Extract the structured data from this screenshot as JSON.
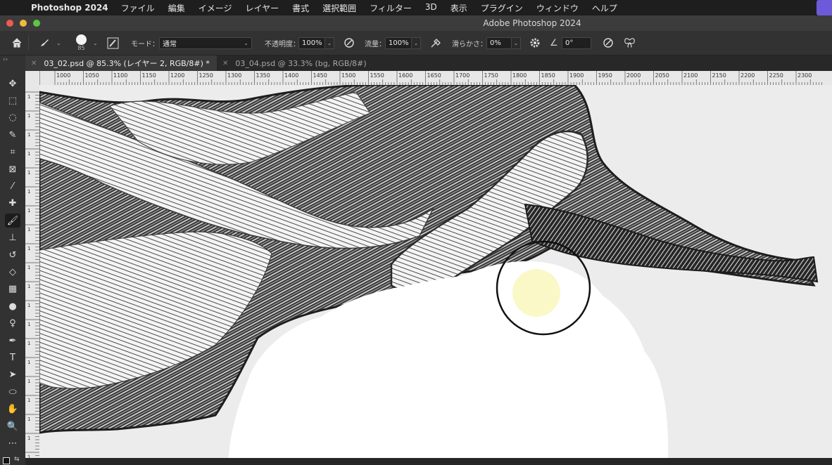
{
  "menubar": {
    "app_name": "Photoshop 2024",
    "items": [
      "ファイル",
      "編集",
      "イメージ",
      "レイヤー",
      "書式",
      "選択範囲",
      "フィルター",
      "3D",
      "表示",
      "プラグイン",
      "ウィンドウ",
      "ヘルプ"
    ]
  },
  "window": {
    "title": "Adobe Photoshop 2024"
  },
  "options_bar": {
    "brush_size": "85",
    "mode_label": "モード：",
    "mode_value": "通常",
    "opacity_label": "不透明度：",
    "opacity_value": "100%",
    "flow_label": "流量：",
    "flow_value": "100%",
    "smoothing_label": "滑らかさ：",
    "smoothing_value": "0%",
    "angle_value": "0°"
  },
  "tabs": [
    {
      "label": "03_02.psd @ 85.3% (レイヤー 2, RGB/8#) *",
      "active": true
    },
    {
      "label": "03_04.psd @ 33.3% (bg, RGB/8#)",
      "active": false
    }
  ],
  "ruler": {
    "h_ticks": [
      "1000",
      "1050",
      "1100",
      "1150",
      "1200",
      "1250",
      "1300",
      "1350",
      "1400",
      "1450",
      "1500",
      "1550",
      "1600",
      "1650",
      "1700",
      "1750",
      "1800",
      "1850",
      "1900",
      "1950",
      "2000",
      "2050",
      "2100",
      "2150",
      "2200",
      "2250",
      "2300"
    ],
    "v_ticks": [
      "1",
      "1",
      "1",
      "1",
      "1",
      "1",
      "1",
      "1",
      "1",
      "1",
      "1",
      "1",
      "1",
      "1",
      "1",
      "1",
      "1",
      "1",
      "1",
      "1"
    ]
  },
  "tools": [
    {
      "name": "move-tool-icon",
      "glyph": "✥"
    },
    {
      "name": "marquee-tool-icon",
      "glyph": "⬚"
    },
    {
      "name": "lasso-tool-icon",
      "glyph": "◌"
    },
    {
      "name": "quick-select-tool-icon",
      "glyph": "✎"
    },
    {
      "name": "crop-tool-icon",
      "glyph": "⌗"
    },
    {
      "name": "frame-tool-icon",
      "glyph": "⊠"
    },
    {
      "name": "eyedropper-tool-icon",
      "glyph": "⁄"
    },
    {
      "name": "healing-brush-tool-icon",
      "glyph": "✚"
    },
    {
      "name": "brush-tool-icon",
      "glyph": "🖌"
    },
    {
      "name": "clone-stamp-tool-icon",
      "glyph": "⊥"
    },
    {
      "name": "history-brush-tool-icon",
      "glyph": "↺"
    },
    {
      "name": "eraser-tool-icon",
      "glyph": "◇"
    },
    {
      "name": "gradient-tool-icon",
      "glyph": "▦"
    },
    {
      "name": "blur-tool-icon",
      "glyph": "●"
    },
    {
      "name": "dodge-tool-icon",
      "glyph": "♀"
    },
    {
      "name": "pen-tool-icon",
      "glyph": "✒"
    },
    {
      "name": "type-tool-icon",
      "glyph": "T"
    },
    {
      "name": "path-select-tool-icon",
      "glyph": "➤"
    },
    {
      "name": "shape-tool-icon",
      "glyph": "⬭"
    },
    {
      "name": "hand-tool-icon",
      "glyph": "✋"
    },
    {
      "name": "zoom-tool-icon",
      "glyph": "🔍"
    },
    {
      "name": "more-tools-icon",
      "glyph": "⋯"
    }
  ],
  "colors": {
    "accent": "#6d5ad8",
    "brush_cursor": "#111111",
    "highlight": "#fbf7c2"
  }
}
